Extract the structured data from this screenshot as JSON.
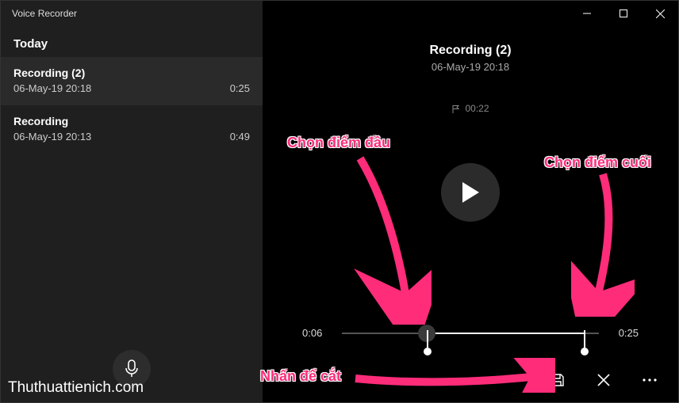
{
  "app": {
    "title": "Voice Recorder"
  },
  "sidebar": {
    "section": "Today",
    "items": [
      {
        "title": "Recording (2)",
        "date": "06-May-19 20:18",
        "duration": "0:25"
      },
      {
        "title": "Recording",
        "date": "06-May-19 20:13",
        "duration": "0:49"
      }
    ]
  },
  "detail": {
    "title": "Recording (2)",
    "date": "06-May-19 20:18",
    "marker_time": "00:22",
    "trim_start": "0:06",
    "trim_end": "0:25"
  },
  "annotations": {
    "start_label": "Chọn điểm đầu",
    "end_label": "Chọn điểm cuối",
    "save_label": "Nhấn để cắt"
  },
  "watermark": "Thuthuattienich.com",
  "colors": {
    "accent": "#ff2c7a"
  }
}
